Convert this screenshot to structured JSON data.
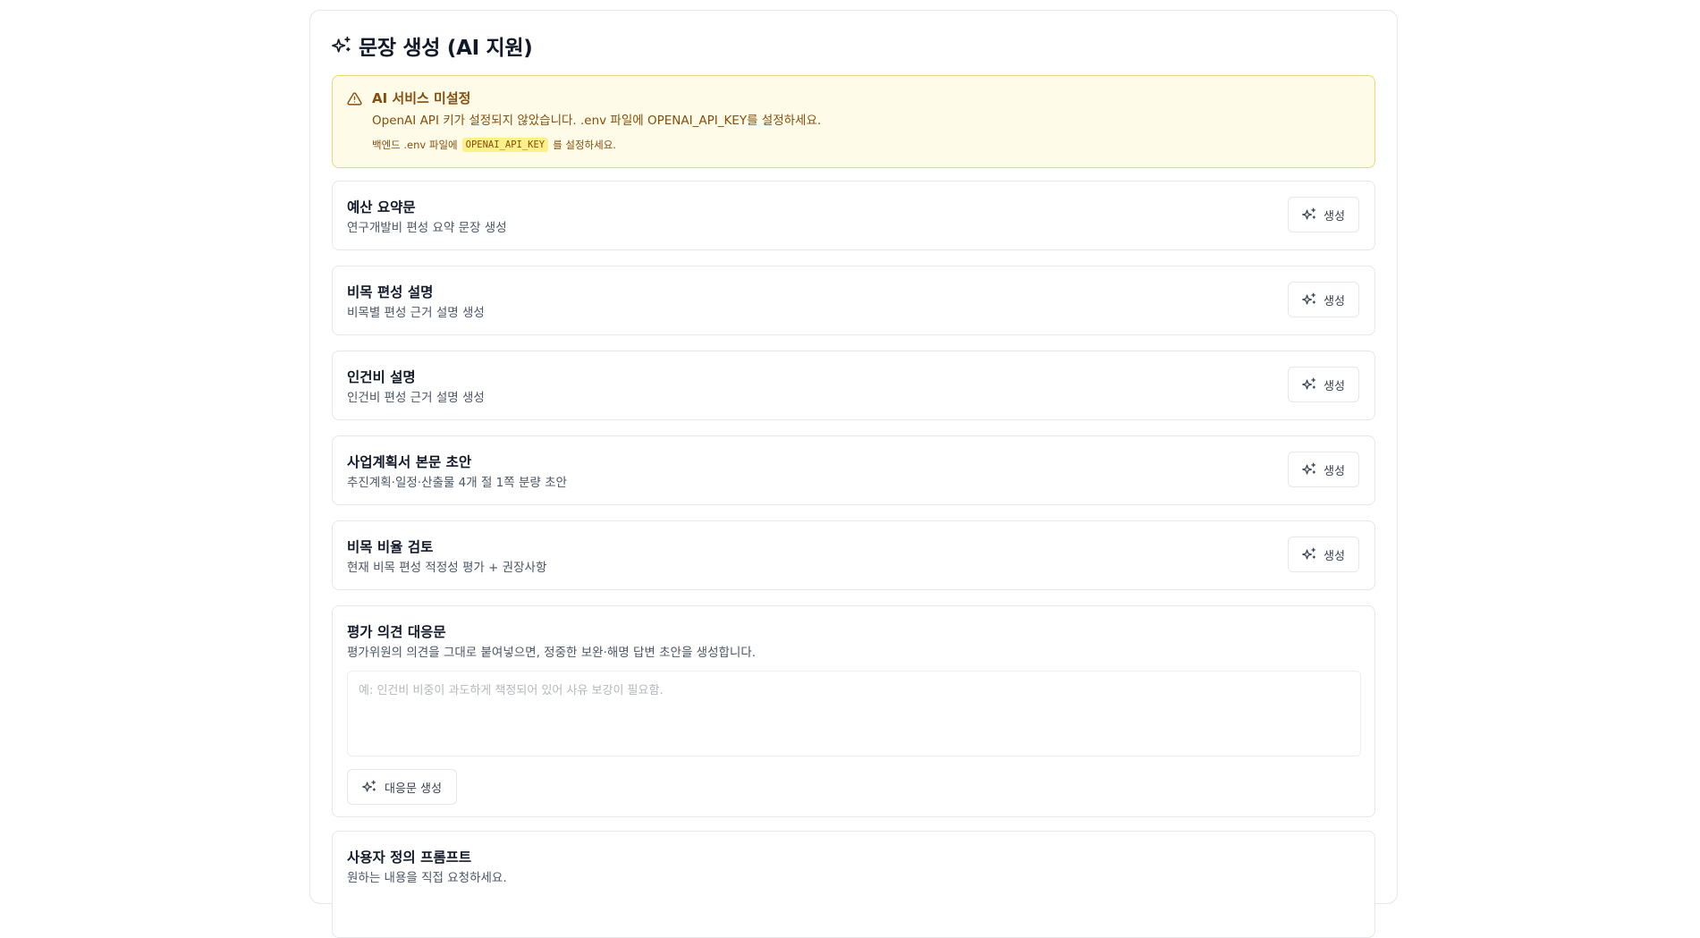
{
  "header": {
    "title": "문장 생성 (AI 지원)",
    "icon": "sparkles-icon"
  },
  "alert": {
    "icon": "warning-triangle-icon",
    "title": "AI 서비스 미설정",
    "message": "OpenAI API 키가 설정되지 않았습니다. .env 파일에 OPENAI_API_KEY를 설정하세요.",
    "hint_prefix": "백엔드 .env 파일에",
    "hint_code": "OPENAI_API_KEY",
    "hint_suffix": "를 설정하세요."
  },
  "cards": [
    {
      "title": "예산 요약문",
      "description": "연구개발비 편성 요약 문장 생성",
      "button_label": "생성"
    },
    {
      "title": "비목 편성 설명",
      "description": "비목별 편성 근거 설명 생성",
      "button_label": "생성"
    },
    {
      "title": "인건비 설명",
      "description": "인건비 편성 근거 설명 생성",
      "button_label": "생성"
    },
    {
      "title": "사업계획서 본문 초안",
      "description": "추진계획·일정·산출물 4개 절 1쪽 분량 초안",
      "button_label": "생성"
    },
    {
      "title": "비목 비율 검토",
      "description": "현재 비목 편성 적정성 평가 + 권장사항",
      "button_label": "생성"
    }
  ],
  "response_card": {
    "title": "평가 의견 대응문",
    "description": "평가위원의 의견을 그대로 붙여넣으면, 정중한 보완·해명 답변 초안을 생성합니다.",
    "textarea_value": "",
    "textarea_placeholder": "예: 인건비 비중이 과도하게 책정되어 있어 사유 보강이 필요함.",
    "button_label": "대응문 생성"
  },
  "custom_card": {
    "title": "사용자 정의 프롬프트",
    "description": "원하는 내용을 직접 요청하세요."
  },
  "colors": {
    "alert_bg": "#fefce8",
    "alert_border": "#eed77a",
    "alert_text": "#854d0e",
    "border": "#e5e7eb"
  }
}
